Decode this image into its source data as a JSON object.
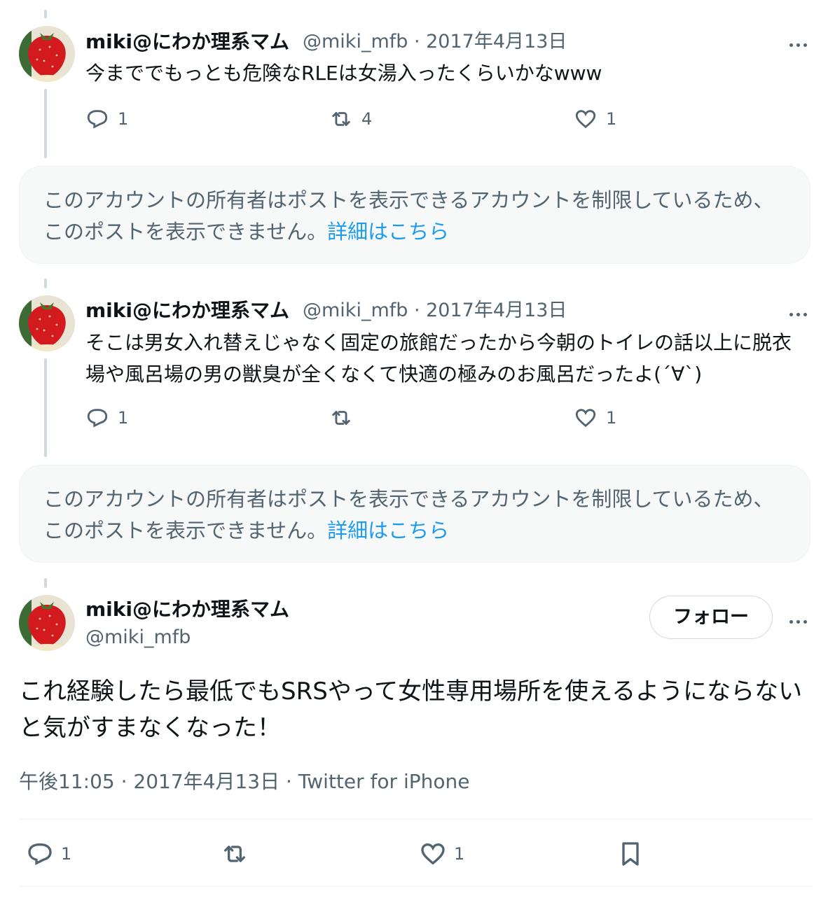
{
  "colors": {
    "text_primary": "#0f1419",
    "text_secondary": "#536471",
    "link": "#1d9bf0",
    "restricted_bg": "#f7f9f9",
    "thread_line": "#cfd9de"
  },
  "author": {
    "display_name": "miki@にわか理系マム",
    "handle": "@miki_mfb",
    "avatar_icon": "strawberry-avatar"
  },
  "thread": [
    {
      "display_name": "miki@にわか理系マム",
      "handle_date": "@miki_mfb · 2017年4月13日",
      "text": "今まででもっとも危険なRLEは女湯入ったくらいかなwww",
      "replies": "1",
      "retweets": "4",
      "likes": "1"
    },
    {
      "display_name": "miki@にわか理系マム",
      "handle_date": "@miki_mfb · 2017年4月13日",
      "text": "そこは男女入れ替えじゃなく固定の旅館だったから今朝のトイレの話以上に脱衣場や風呂場の男の獣臭が全くなくて快適の極みのお風呂だったよ(´∀`)",
      "replies": "1",
      "retweets": "",
      "likes": "1"
    }
  ],
  "restricted_notice": {
    "text": "このアカウントの所有者はポストを表示できるアカウントを制限しているため、このポストを表示できません。",
    "link": "詳細はこちら"
  },
  "main_tweet": {
    "display_name": "miki@にわか理系マム",
    "handle": "@miki_mfb",
    "follow_label": "フォロー",
    "text": "これ経験したら最低でもSRSやって女性専用場所を使えるようにならないと気がすまなくなった！",
    "timestamp": "午後11:05 · 2017年4月13日 · Twitter for iPhone",
    "replies": "1",
    "retweets": "",
    "likes": "1"
  },
  "icons": {
    "reply": "reply-icon",
    "retweet": "retweet-icon",
    "like": "heart-icon",
    "bookmark": "bookmark-icon",
    "more": "more-icon"
  }
}
